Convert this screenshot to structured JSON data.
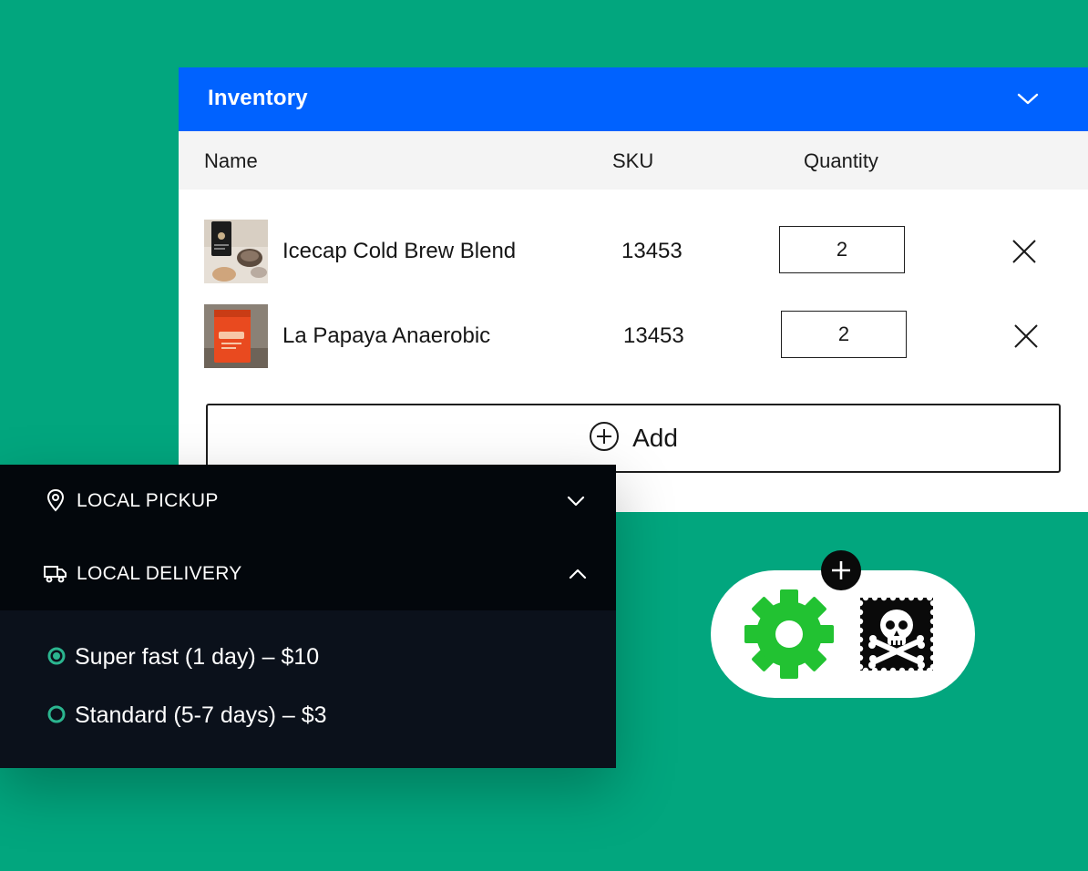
{
  "inventory": {
    "title": "Inventory",
    "collapse_icon": "chevron-down-icon",
    "columns": {
      "name": "Name",
      "sku": "SKU",
      "quantity": "Quantity"
    },
    "items": [
      {
        "name": "Icecap Cold Brew Blend",
        "sku": "13453",
        "quantity": "2",
        "thumbnail": "coffee-bag-dark-photo"
      },
      {
        "name": "La Papaya Anaerobic",
        "sku": "13453",
        "quantity": "2",
        "thumbnail": "coffee-bag-red-photo"
      }
    ],
    "remove_icon": "close-icon",
    "add_label": "Add",
    "add_icon": "plus-circle-icon"
  },
  "shipping": {
    "methods": [
      {
        "label": "LOCAL PICKUP",
        "icon": "location-pin-icon",
        "expanded": false
      },
      {
        "label": "LOCAL DELIVERY",
        "icon": "truck-icon",
        "expanded": true
      }
    ],
    "options": [
      {
        "label": "Super fast (1 day) – $10",
        "selected": true
      },
      {
        "label": "Standard (5-7 days) – $3",
        "selected": false
      }
    ]
  },
  "integrations": {
    "icons": [
      "gear-icon",
      "skull-crossbones-stamp-icon"
    ],
    "add_icon": "plus-icon"
  },
  "colors": {
    "background": "#02a67e",
    "header_blue": "#0062ff",
    "dark_panel": "#0b111b",
    "radio_accent": "#2bb58f",
    "gear_green": "#22c232"
  }
}
